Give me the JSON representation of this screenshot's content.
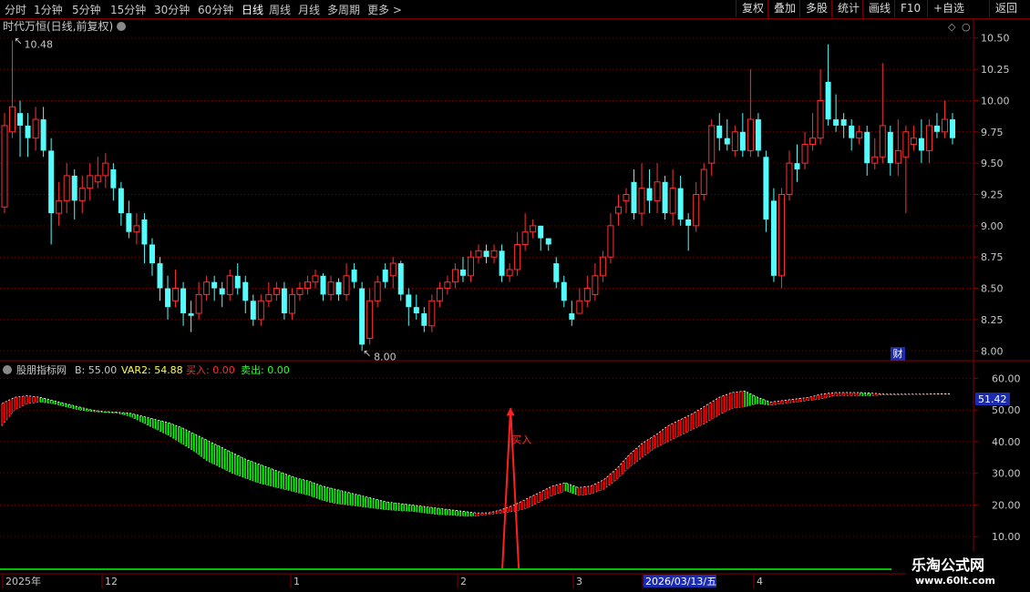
{
  "timeframes": [
    {
      "label": "分时",
      "active": false
    },
    {
      "label": "1分钟",
      "active": false
    },
    {
      "label": "5分钟",
      "active": false
    },
    {
      "label": "15分钟",
      "active": false
    },
    {
      "label": "30分钟",
      "active": false
    },
    {
      "label": "60分钟",
      "active": false
    },
    {
      "label": "日线",
      "active": true
    },
    {
      "label": "周线",
      "active": false
    },
    {
      "label": "月线",
      "active": false
    },
    {
      "label": "多周期",
      "active": false
    },
    {
      "label": "更多 >",
      "active": false
    }
  ],
  "toolbar_right": [
    "复权",
    "叠加",
    "多股",
    "统计",
    "画线",
    "F10",
    "+自选",
    "返回"
  ],
  "main_title": "时代万恒(日线,前复权)",
  "price_axis_ticks": [
    "10.50",
    "10.25",
    "10.00",
    "9.75",
    "9.50",
    "9.25",
    "9.00",
    "8.75",
    "8.50",
    "8.25",
    "8.00"
  ],
  "high_label": "10.48",
  "low_label": "8.00",
  "badge": "财",
  "indicator": {
    "name": "股朋指标网",
    "b_label": "B: 55.00",
    "var2_label": "VAR2: 54.88",
    "buy_label": "买入: 0.00",
    "sell_label": "卖出: 0.00",
    "current_value": "51.42",
    "signal_text": "买入"
  },
  "indicator_axis_ticks": [
    "60.00",
    "50.00",
    "40.00",
    "30.00",
    "20.00",
    "10.00"
  ],
  "date_axis": [
    "2025年",
    "12",
    "1",
    "2",
    "3",
    "2026/03/13/五",
    "4"
  ],
  "watermark": {
    "title": "乐淘公式网",
    "url": "www.60lt.com"
  },
  "colors": {
    "up": "#ff3030",
    "down": "#54fcfc",
    "ribbon_up": "#ff0000",
    "ribbon_down": "#00ff00",
    "axis": "#8b0000",
    "grid": "#7a0000",
    "baseline": "#00c000"
  },
  "chart_data": {
    "type": "candlestick",
    "price_range": [
      7.98,
      10.6
    ],
    "candles": [
      [
        9.15,
        9.8,
        9.9,
        9.1
      ],
      [
        9.75,
        9.95,
        10.48,
        9.7
      ],
      [
        9.9,
        9.8,
        10.0,
        9.55
      ],
      [
        9.8,
        9.7,
        9.9,
        9.55
      ],
      [
        9.7,
        9.85,
        9.95,
        9.6
      ],
      [
        9.85,
        9.6,
        9.95,
        9.55
      ],
      [
        9.6,
        9.1,
        9.7,
        8.85
      ],
      [
        9.1,
        9.2,
        9.35,
        9.0
      ],
      [
        9.2,
        9.4,
        9.5,
        9.1
      ],
      [
        9.4,
        9.2,
        9.45,
        9.05
      ],
      [
        9.2,
        9.3,
        9.4,
        9.1
      ],
      [
        9.3,
        9.4,
        9.5,
        9.2
      ],
      [
        9.35,
        9.4,
        9.55,
        9.3
      ],
      [
        9.4,
        9.5,
        9.58,
        9.3
      ],
      [
        9.45,
        9.3,
        9.5,
        9.2
      ],
      [
        9.3,
        9.1,
        9.35,
        9.0
      ],
      [
        9.1,
        8.95,
        9.2,
        8.9
      ],
      [
        8.95,
        9.0,
        9.1,
        8.85
      ],
      [
        9.05,
        8.85,
        9.1,
        8.7
      ],
      [
        8.85,
        8.7,
        8.9,
        8.6
      ],
      [
        8.7,
        8.5,
        8.75,
        8.4
      ],
      [
        8.5,
        8.35,
        8.6,
        8.25
      ],
      [
        8.4,
        8.5,
        8.65,
        8.35
      ],
      [
        8.5,
        8.3,
        8.55,
        8.2
      ],
      [
        8.3,
        8.28,
        8.4,
        8.15
      ],
      [
        8.3,
        8.45,
        8.55,
        8.25
      ],
      [
        8.45,
        8.55,
        8.6,
        8.4
      ],
      [
        8.55,
        8.5,
        8.6,
        8.4
      ],
      [
        8.5,
        8.45,
        8.55,
        8.35
      ],
      [
        8.45,
        8.6,
        8.65,
        8.4
      ],
      [
        8.6,
        8.5,
        8.7,
        8.45
      ],
      [
        8.55,
        8.4,
        8.6,
        8.3
      ],
      [
        8.4,
        8.25,
        8.45,
        8.2
      ],
      [
        8.25,
        8.4,
        8.45,
        8.2
      ],
      [
        8.4,
        8.45,
        8.55,
        8.35
      ],
      [
        8.45,
        8.5,
        8.55,
        8.4
      ],
      [
        8.5,
        8.3,
        8.55,
        8.25
      ],
      [
        8.3,
        8.45,
        8.5,
        8.25
      ],
      [
        8.45,
        8.5,
        8.55,
        8.4
      ],
      [
        8.5,
        8.55,
        8.6,
        8.45
      ],
      [
        8.55,
        8.6,
        8.65,
        8.5
      ],
      [
        8.6,
        8.45,
        8.62,
        8.4
      ],
      [
        8.45,
        8.55,
        8.6,
        8.4
      ],
      [
        8.55,
        8.45,
        8.58,
        8.4
      ],
      [
        8.45,
        8.6,
        8.7,
        8.4
      ],
      [
        8.65,
        8.55,
        8.7,
        8.5
      ],
      [
        8.5,
        8.05,
        8.55,
        8.0
      ],
      [
        8.1,
        8.4,
        8.5,
        8.05
      ],
      [
        8.4,
        8.55,
        8.6,
        8.35
      ],
      [
        8.65,
        8.55,
        8.7,
        8.5
      ],
      [
        8.6,
        8.7,
        8.75,
        8.5
      ],
      [
        8.7,
        8.45,
        8.72,
        8.4
      ],
      [
        8.45,
        8.35,
        8.5,
        8.2
      ],
      [
        8.35,
        8.3,
        8.45,
        8.25
      ],
      [
        8.3,
        8.2,
        8.35,
        8.15
      ],
      [
        8.2,
        8.4,
        8.45,
        8.15
      ],
      [
        8.4,
        8.5,
        8.55,
        8.35
      ],
      [
        8.5,
        8.55,
        8.6,
        8.45
      ],
      [
        8.55,
        8.65,
        8.7,
        8.5
      ],
      [
        8.65,
        8.6,
        8.75,
        8.55
      ],
      [
        8.6,
        8.75,
        8.8,
        8.55
      ],
      [
        8.75,
        8.8,
        8.85,
        8.7
      ],
      [
        8.8,
        8.75,
        8.85,
        8.7
      ],
      [
        8.75,
        8.8,
        8.85,
        8.7
      ],
      [
        8.8,
        8.6,
        8.85,
        8.55
      ],
      [
        8.6,
        8.65,
        8.7,
        8.55
      ],
      [
        8.65,
        8.85,
        8.95,
        8.6
      ],
      [
        8.85,
        8.95,
        9.1,
        8.8
      ],
      [
        8.95,
        9.0,
        9.05,
        8.9
      ],
      [
        9.0,
        8.9,
        9.0,
        8.8
      ],
      [
        8.9,
        8.85,
        8.9,
        8.8
      ],
      [
        8.7,
        8.55,
        8.75,
        8.5
      ],
      [
        8.55,
        8.4,
        8.6,
        8.35
      ],
      [
        8.3,
        8.25,
        8.4,
        8.2
      ],
      [
        8.3,
        8.4,
        8.5,
        8.3
      ],
      [
        8.4,
        8.5,
        8.6,
        8.35
      ],
      [
        8.45,
        8.6,
        8.7,
        8.4
      ],
      [
        8.6,
        8.75,
        8.8,
        8.55
      ],
      [
        8.75,
        9.0,
        9.1,
        8.7
      ],
      [
        9.1,
        9.15,
        9.25,
        9.0
      ],
      [
        9.2,
        9.25,
        9.3,
        9.1
      ],
      [
        9.35,
        9.1,
        9.45,
        9.05
      ],
      [
        9.1,
        9.3,
        9.5,
        9.0
      ],
      [
        9.3,
        9.2,
        9.45,
        9.1
      ],
      [
        9.2,
        9.35,
        9.5,
        9.1
      ],
      [
        9.35,
        9.1,
        9.4,
        9.05
      ],
      [
        9.1,
        9.3,
        9.45,
        9.0
      ],
      [
        9.3,
        9.05,
        9.4,
        9.0
      ],
      [
        9.05,
        9.0,
        9.1,
        8.8
      ],
      [
        9.0,
        9.25,
        9.35,
        8.95
      ],
      [
        9.25,
        9.45,
        9.5,
        9.2
      ],
      [
        9.5,
        9.8,
        9.85,
        9.4
      ],
      [
        9.8,
        9.7,
        9.9,
        9.6
      ],
      [
        9.7,
        9.65,
        9.85,
        9.6
      ],
      [
        9.6,
        9.75,
        9.8,
        9.55
      ],
      [
        9.75,
        9.6,
        9.9,
        9.55
      ],
      [
        9.6,
        9.85,
        10.25,
        9.55
      ],
      [
        9.85,
        9.6,
        9.9,
        9.55
      ],
      [
        9.55,
        9.05,
        9.6,
        8.95
      ],
      [
        9.2,
        8.6,
        9.3,
        8.55
      ],
      [
        8.6,
        9.25,
        9.3,
        8.5
      ],
      [
        9.25,
        9.5,
        9.6,
        9.2
      ],
      [
        9.5,
        9.45,
        9.65,
        9.35
      ],
      [
        9.5,
        9.65,
        9.75,
        9.45
      ],
      [
        9.65,
        9.7,
        9.9,
        9.6
      ],
      [
        9.7,
        10.0,
        10.25,
        9.65
      ],
      [
        10.15,
        9.85,
        10.45,
        9.8
      ],
      [
        9.85,
        9.8,
        10.05,
        9.75
      ],
      [
        9.85,
        9.8,
        9.9,
        9.7
      ],
      [
        9.8,
        9.7,
        9.85,
        9.6
      ],
      [
        9.7,
        9.75,
        9.8,
        9.65
      ],
      [
        9.75,
        9.5,
        9.8,
        9.4
      ],
      [
        9.5,
        9.55,
        9.7,
        9.45
      ],
      [
        9.55,
        9.8,
        10.3,
        9.5
      ],
      [
        9.75,
        9.5,
        9.8,
        9.4
      ],
      [
        9.5,
        9.6,
        9.85,
        9.4
      ],
      [
        9.55,
        9.75,
        9.8,
        9.1
      ],
      [
        9.65,
        9.7,
        9.8,
        9.6
      ],
      [
        9.7,
        9.6,
        9.85,
        9.5
      ],
      [
        9.6,
        9.8,
        9.85,
        9.5
      ],
      [
        9.8,
        9.75,
        9.9,
        9.7
      ],
      [
        9.75,
        9.85,
        10.0,
        9.7
      ],
      [
        9.85,
        9.7,
        9.9,
        9.65
      ]
    ],
    "indicator_range": [
      0,
      65
    ],
    "ribbon": [
      [
        45,
        52
      ],
      [
        50,
        54
      ],
      [
        52,
        54.5
      ],
      [
        52.5,
        54
      ],
      [
        52,
        53
      ],
      [
        51,
        52
      ],
      [
        50,
        51
      ],
      [
        49.5,
        50
      ],
      [
        49.2,
        49.5
      ],
      [
        49,
        49.3
      ],
      [
        48,
        49
      ],
      [
        46,
        48
      ],
      [
        44,
        47
      ],
      [
        42,
        46
      ],
      [
        39.5,
        44.5
      ],
      [
        37,
        42.5
      ],
      [
        34,
        40.5
      ],
      [
        32,
        38.5
      ],
      [
        30,
        36.5
      ],
      [
        28.5,
        34.5
      ],
      [
        27,
        33
      ],
      [
        26,
        31.5
      ],
      [
        25,
        30
      ],
      [
        24,
        28.5
      ],
      [
        23,
        27.5
      ],
      [
        21.5,
        26
      ],
      [
        20.5,
        25
      ],
      [
        20,
        24
      ],
      [
        19.5,
        23
      ],
      [
        19,
        22
      ],
      [
        18.5,
        21
      ],
      [
        18.2,
        20.5
      ],
      [
        18,
        20
      ],
      [
        17.5,
        19.5
      ],
      [
        17,
        19
      ],
      [
        16.8,
        18.5
      ],
      [
        16.5,
        18
      ],
      [
        16.5,
        17.5
      ],
      [
        17,
        17.5
      ],
      [
        17.5,
        18.5
      ],
      [
        18,
        20
      ],
      [
        19,
        22
      ],
      [
        21,
        24
      ],
      [
        23,
        26
      ],
      [
        24.5,
        27
      ],
      [
        23,
        25.5
      ],
      [
        23.5,
        26
      ],
      [
        25,
        28
      ],
      [
        28,
        31.5
      ],
      [
        32,
        36
      ],
      [
        35,
        39.5
      ],
      [
        38,
        42
      ],
      [
        40,
        45
      ],
      [
        42,
        47
      ],
      [
        44,
        49
      ],
      [
        46,
        51.5
      ],
      [
        48.5,
        54
      ],
      [
        50.5,
        55.5
      ],
      [
        51,
        56
      ],
      [
        52,
        54
      ],
      [
        51.5,
        52.5
      ],
      [
        52,
        53
      ],
      [
        52.5,
        53.5
      ],
      [
        53,
        54
      ],
      [
        53.5,
        55
      ],
      [
        54.5,
        55.5
      ],
      [
        54.5,
        55.5
      ],
      [
        54.5,
        55.5
      ],
      [
        54.5,
        55.3
      ],
      [
        54.8,
        55
      ],
      [
        54.8,
        55
      ],
      [
        54.9,
        55
      ],
      [
        54.9,
        55
      ],
      [
        55,
        55.1
      ],
      [
        55,
        55.1
      ]
    ],
    "buy_signal_index": 39,
    "buy_signal_peak": 50.5
  }
}
